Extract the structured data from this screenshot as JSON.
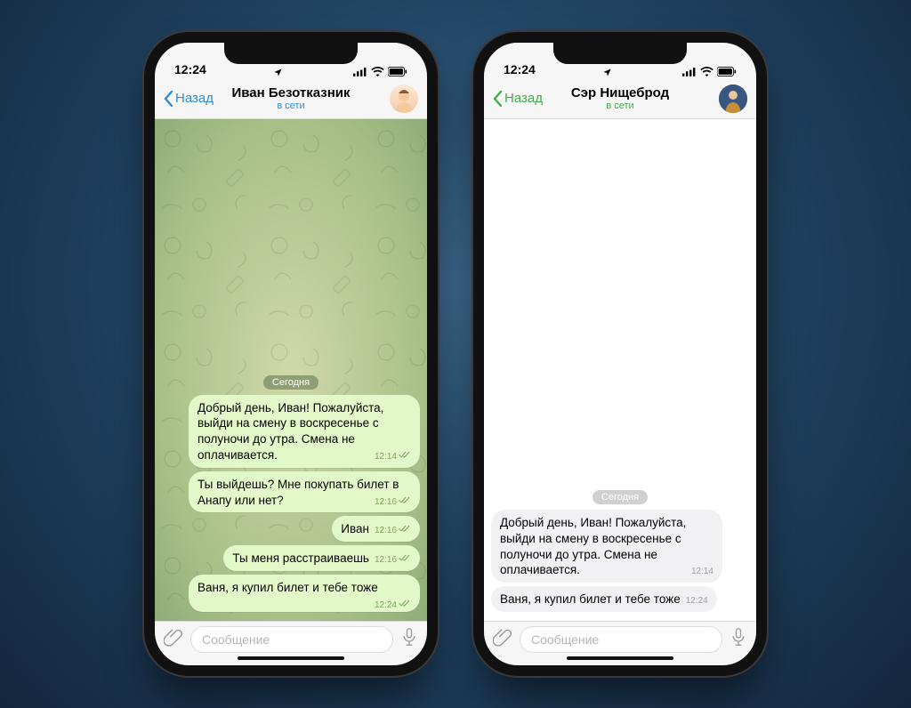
{
  "status_time": "12:24",
  "back_label": "Назад",
  "online_label": "в сети",
  "date_label": "Сегодня",
  "input_placeholder": "Сообщение",
  "phones": {
    "a": {
      "contact_name": "Иван Безотказник",
      "messages": [
        {
          "text": "Добрый день, Иван! Пожалуйста, выйди на смену в воскресенье с полуночи до утра. Смена не оплачивается.",
          "time": "12:14",
          "dir": "out"
        },
        {
          "text": "Ты выйдешь? Мне покупать билет в Анапу или нет?",
          "time": "12:16",
          "dir": "out"
        },
        {
          "text": "Иван",
          "time": "12:16",
          "dir": "out"
        },
        {
          "text": "Ты меня расстраиваешь",
          "time": "12:16",
          "dir": "out"
        },
        {
          "text": "Ваня, я купил билет и тебе тоже",
          "time": "12:24",
          "dir": "out"
        }
      ]
    },
    "b": {
      "contact_name": "Сэр Нищеброд",
      "messages": [
        {
          "text": "Добрый день, Иван! Пожалуйста, выйди на смену в воскресенье с полуночи до утра. Смена не оплачивается.",
          "time": "12:14",
          "dir": "in"
        },
        {
          "text": "Ваня, я купил билет и тебе тоже",
          "time": "12:24",
          "dir": "in"
        }
      ]
    }
  }
}
